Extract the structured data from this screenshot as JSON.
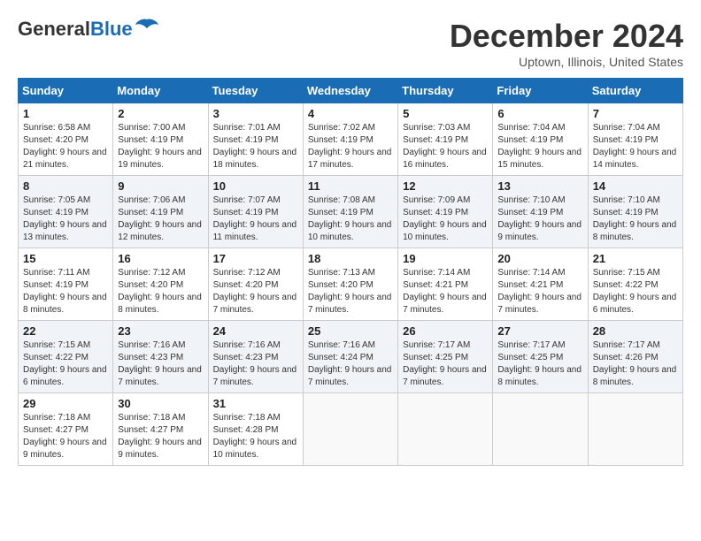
{
  "header": {
    "logo_general": "General",
    "logo_blue": "Blue",
    "month_title": "December 2024",
    "location": "Uptown, Illinois, United States"
  },
  "weekdays": [
    "Sunday",
    "Monday",
    "Tuesday",
    "Wednesday",
    "Thursday",
    "Friday",
    "Saturday"
  ],
  "weeks": [
    [
      {
        "day": "1",
        "sunrise": "Sunrise: 6:58 AM",
        "sunset": "Sunset: 4:20 PM",
        "daylight": "Daylight: 9 hours and 21 minutes."
      },
      {
        "day": "2",
        "sunrise": "Sunrise: 7:00 AM",
        "sunset": "Sunset: 4:19 PM",
        "daylight": "Daylight: 9 hours and 19 minutes."
      },
      {
        "day": "3",
        "sunrise": "Sunrise: 7:01 AM",
        "sunset": "Sunset: 4:19 PM",
        "daylight": "Daylight: 9 hours and 18 minutes."
      },
      {
        "day": "4",
        "sunrise": "Sunrise: 7:02 AM",
        "sunset": "Sunset: 4:19 PM",
        "daylight": "Daylight: 9 hours and 17 minutes."
      },
      {
        "day": "5",
        "sunrise": "Sunrise: 7:03 AM",
        "sunset": "Sunset: 4:19 PM",
        "daylight": "Daylight: 9 hours and 16 minutes."
      },
      {
        "day": "6",
        "sunrise": "Sunrise: 7:04 AM",
        "sunset": "Sunset: 4:19 PM",
        "daylight": "Daylight: 9 hours and 15 minutes."
      },
      {
        "day": "7",
        "sunrise": "Sunrise: 7:04 AM",
        "sunset": "Sunset: 4:19 PM",
        "daylight": "Daylight: 9 hours and 14 minutes."
      }
    ],
    [
      {
        "day": "8",
        "sunrise": "Sunrise: 7:05 AM",
        "sunset": "Sunset: 4:19 PM",
        "daylight": "Daylight: 9 hours and 13 minutes."
      },
      {
        "day": "9",
        "sunrise": "Sunrise: 7:06 AM",
        "sunset": "Sunset: 4:19 PM",
        "daylight": "Daylight: 9 hours and 12 minutes."
      },
      {
        "day": "10",
        "sunrise": "Sunrise: 7:07 AM",
        "sunset": "Sunset: 4:19 PM",
        "daylight": "Daylight: 9 hours and 11 minutes."
      },
      {
        "day": "11",
        "sunrise": "Sunrise: 7:08 AM",
        "sunset": "Sunset: 4:19 PM",
        "daylight": "Daylight: 9 hours and 10 minutes."
      },
      {
        "day": "12",
        "sunrise": "Sunrise: 7:09 AM",
        "sunset": "Sunset: 4:19 PM",
        "daylight": "Daylight: 9 hours and 10 minutes."
      },
      {
        "day": "13",
        "sunrise": "Sunrise: 7:10 AM",
        "sunset": "Sunset: 4:19 PM",
        "daylight": "Daylight: 9 hours and 9 minutes."
      },
      {
        "day": "14",
        "sunrise": "Sunrise: 7:10 AM",
        "sunset": "Sunset: 4:19 PM",
        "daylight": "Daylight: 9 hours and 8 minutes."
      }
    ],
    [
      {
        "day": "15",
        "sunrise": "Sunrise: 7:11 AM",
        "sunset": "Sunset: 4:19 PM",
        "daylight": "Daylight: 9 hours and 8 minutes."
      },
      {
        "day": "16",
        "sunrise": "Sunrise: 7:12 AM",
        "sunset": "Sunset: 4:20 PM",
        "daylight": "Daylight: 9 hours and 8 minutes."
      },
      {
        "day": "17",
        "sunrise": "Sunrise: 7:12 AM",
        "sunset": "Sunset: 4:20 PM",
        "daylight": "Daylight: 9 hours and 7 minutes."
      },
      {
        "day": "18",
        "sunrise": "Sunrise: 7:13 AM",
        "sunset": "Sunset: 4:20 PM",
        "daylight": "Daylight: 9 hours and 7 minutes."
      },
      {
        "day": "19",
        "sunrise": "Sunrise: 7:14 AM",
        "sunset": "Sunset: 4:21 PM",
        "daylight": "Daylight: 9 hours and 7 minutes."
      },
      {
        "day": "20",
        "sunrise": "Sunrise: 7:14 AM",
        "sunset": "Sunset: 4:21 PM",
        "daylight": "Daylight: 9 hours and 7 minutes."
      },
      {
        "day": "21",
        "sunrise": "Sunrise: 7:15 AM",
        "sunset": "Sunset: 4:22 PM",
        "daylight": "Daylight: 9 hours and 6 minutes."
      }
    ],
    [
      {
        "day": "22",
        "sunrise": "Sunrise: 7:15 AM",
        "sunset": "Sunset: 4:22 PM",
        "daylight": "Daylight: 9 hours and 6 minutes."
      },
      {
        "day": "23",
        "sunrise": "Sunrise: 7:16 AM",
        "sunset": "Sunset: 4:23 PM",
        "daylight": "Daylight: 9 hours and 7 minutes."
      },
      {
        "day": "24",
        "sunrise": "Sunrise: 7:16 AM",
        "sunset": "Sunset: 4:23 PM",
        "daylight": "Daylight: 9 hours and 7 minutes."
      },
      {
        "day": "25",
        "sunrise": "Sunrise: 7:16 AM",
        "sunset": "Sunset: 4:24 PM",
        "daylight": "Daylight: 9 hours and 7 minutes."
      },
      {
        "day": "26",
        "sunrise": "Sunrise: 7:17 AM",
        "sunset": "Sunset: 4:25 PM",
        "daylight": "Daylight: 9 hours and 7 minutes."
      },
      {
        "day": "27",
        "sunrise": "Sunrise: 7:17 AM",
        "sunset": "Sunset: 4:25 PM",
        "daylight": "Daylight: 9 hours and 8 minutes."
      },
      {
        "day": "28",
        "sunrise": "Sunrise: 7:17 AM",
        "sunset": "Sunset: 4:26 PM",
        "daylight": "Daylight: 9 hours and 8 minutes."
      }
    ],
    [
      {
        "day": "29",
        "sunrise": "Sunrise: 7:18 AM",
        "sunset": "Sunset: 4:27 PM",
        "daylight": "Daylight: 9 hours and 9 minutes."
      },
      {
        "day": "30",
        "sunrise": "Sunrise: 7:18 AM",
        "sunset": "Sunset: 4:27 PM",
        "daylight": "Daylight: 9 hours and 9 minutes."
      },
      {
        "day": "31",
        "sunrise": "Sunrise: 7:18 AM",
        "sunset": "Sunset: 4:28 PM",
        "daylight": "Daylight: 9 hours and 10 minutes."
      },
      null,
      null,
      null,
      null
    ]
  ]
}
